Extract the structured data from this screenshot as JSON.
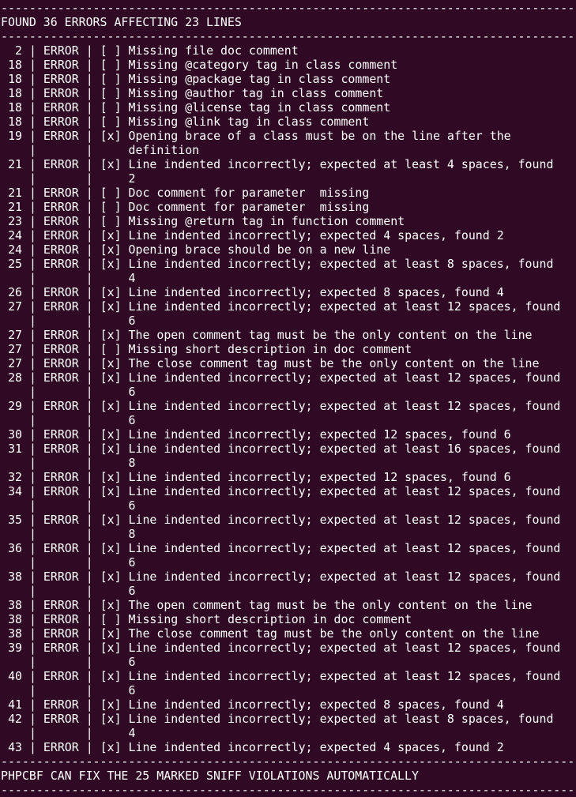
{
  "terminal": {
    "background": "#300a24",
    "foreground": "#ffffff",
    "separator": "---------------------------------------------------------------------------------",
    "summary": "FOUND 36 ERRORS AFFECTING 23 LINES",
    "footer": "PHPCBF CAN FIX THE 25 MARKED SNIFF VIOLATIONS AUTOMATICALLY",
    "errors": [
      {
        "line": "2",
        "type": "ERROR",
        "fix": "[ ]",
        "message": [
          "Missing file doc comment"
        ]
      },
      {
        "line": "18",
        "type": "ERROR",
        "fix": "[ ]",
        "message": [
          "Missing @category tag in class comment"
        ]
      },
      {
        "line": "18",
        "type": "ERROR",
        "fix": "[ ]",
        "message": [
          "Missing @package tag in class comment"
        ]
      },
      {
        "line": "18",
        "type": "ERROR",
        "fix": "[ ]",
        "message": [
          "Missing @author tag in class comment"
        ]
      },
      {
        "line": "18",
        "type": "ERROR",
        "fix": "[ ]",
        "message": [
          "Missing @license tag in class comment"
        ]
      },
      {
        "line": "18",
        "type": "ERROR",
        "fix": "[ ]",
        "message": [
          "Missing @link tag in class comment"
        ]
      },
      {
        "line": "19",
        "type": "ERROR",
        "fix": "[x]",
        "message": [
          "Opening brace of a class must be on the line after the",
          "definition"
        ]
      },
      {
        "line": "21",
        "type": "ERROR",
        "fix": "[x]",
        "message": [
          "Line indented incorrectly; expected at least 4 spaces, found",
          "2"
        ]
      },
      {
        "line": "21",
        "type": "ERROR",
        "fix": "[ ]",
        "message": [
          "Doc comment for parameter  missing"
        ]
      },
      {
        "line": "21",
        "type": "ERROR",
        "fix": "[ ]",
        "message": [
          "Doc comment for parameter  missing"
        ]
      },
      {
        "line": "23",
        "type": "ERROR",
        "fix": "[ ]",
        "message": [
          "Missing @return tag in function comment"
        ]
      },
      {
        "line": "24",
        "type": "ERROR",
        "fix": "[x]",
        "message": [
          "Line indented incorrectly; expected 4 spaces, found 2"
        ]
      },
      {
        "line": "24",
        "type": "ERROR",
        "fix": "[x]",
        "message": [
          "Opening brace should be on a new line"
        ]
      },
      {
        "line": "25",
        "type": "ERROR",
        "fix": "[x]",
        "message": [
          "Line indented incorrectly; expected at least 8 spaces, found",
          "4"
        ]
      },
      {
        "line": "26",
        "type": "ERROR",
        "fix": "[x]",
        "message": [
          "Line indented incorrectly; expected 8 spaces, found 4"
        ]
      },
      {
        "line": "27",
        "type": "ERROR",
        "fix": "[x]",
        "message": [
          "Line indented incorrectly; expected at least 12 spaces, found",
          "6"
        ]
      },
      {
        "line": "27",
        "type": "ERROR",
        "fix": "[x]",
        "message": [
          "The open comment tag must be the only content on the line"
        ]
      },
      {
        "line": "27",
        "type": "ERROR",
        "fix": "[ ]",
        "message": [
          "Missing short description in doc comment"
        ]
      },
      {
        "line": "27",
        "type": "ERROR",
        "fix": "[x]",
        "message": [
          "The close comment tag must be the only content on the line"
        ]
      },
      {
        "line": "28",
        "type": "ERROR",
        "fix": "[x]",
        "message": [
          "Line indented incorrectly; expected at least 12 spaces, found",
          "6"
        ]
      },
      {
        "line": "29",
        "type": "ERROR",
        "fix": "[x]",
        "message": [
          "Line indented incorrectly; expected at least 12 spaces, found",
          "6"
        ]
      },
      {
        "line": "30",
        "type": "ERROR",
        "fix": "[x]",
        "message": [
          "Line indented incorrectly; expected 12 spaces, found 6"
        ]
      },
      {
        "line": "31",
        "type": "ERROR",
        "fix": "[x]",
        "message": [
          "Line indented incorrectly; expected at least 16 spaces, found",
          "8"
        ]
      },
      {
        "line": "32",
        "type": "ERROR",
        "fix": "[x]",
        "message": [
          "Line indented incorrectly; expected 12 spaces, found 6"
        ]
      },
      {
        "line": "34",
        "type": "ERROR",
        "fix": "[x]",
        "message": [
          "Line indented incorrectly; expected at least 12 spaces, found",
          "6"
        ]
      },
      {
        "line": "35",
        "type": "ERROR",
        "fix": "[x]",
        "message": [
          "Line indented incorrectly; expected at least 12 spaces, found",
          "8"
        ]
      },
      {
        "line": "36",
        "type": "ERROR",
        "fix": "[x]",
        "message": [
          "Line indented incorrectly; expected at least 12 spaces, found",
          "6"
        ]
      },
      {
        "line": "38",
        "type": "ERROR",
        "fix": "[x]",
        "message": [
          "Line indented incorrectly; expected at least 12 spaces, found",
          "6"
        ]
      },
      {
        "line": "38",
        "type": "ERROR",
        "fix": "[x]",
        "message": [
          "The open comment tag must be the only content on the line"
        ]
      },
      {
        "line": "38",
        "type": "ERROR",
        "fix": "[ ]",
        "message": [
          "Missing short description in doc comment"
        ]
      },
      {
        "line": "38",
        "type": "ERROR",
        "fix": "[x]",
        "message": [
          "The close comment tag must be the only content on the line"
        ]
      },
      {
        "line": "39",
        "type": "ERROR",
        "fix": "[x]",
        "message": [
          "Line indented incorrectly; expected at least 12 spaces, found",
          "6"
        ]
      },
      {
        "line": "40",
        "type": "ERROR",
        "fix": "[x]",
        "message": [
          "Line indented incorrectly; expected at least 12 spaces, found",
          "6"
        ]
      },
      {
        "line": "41",
        "type": "ERROR",
        "fix": "[x]",
        "message": [
          "Line indented incorrectly; expected 8 spaces, found 4"
        ]
      },
      {
        "line": "42",
        "type": "ERROR",
        "fix": "[x]",
        "message": [
          "Line indented incorrectly; expected at least 8 spaces, found",
          "4"
        ]
      },
      {
        "line": "43",
        "type": "ERROR",
        "fix": "[x]",
        "message": [
          "Line indented incorrectly; expected 4 spaces, found 2"
        ]
      }
    ]
  }
}
